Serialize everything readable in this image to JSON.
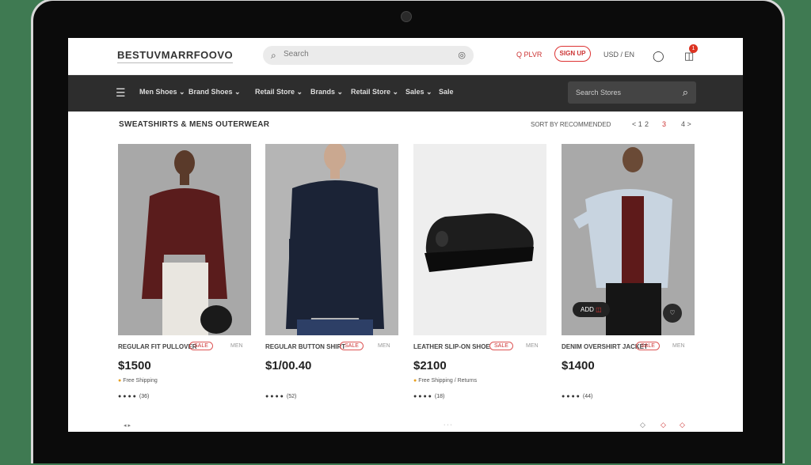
{
  "header": {
    "brand": "BESTUVMARRFOOVO",
    "search_placeholder": "Search",
    "search_icon": "search-icon",
    "mic_icon": "camera-icon",
    "help_label": "Q PLVR",
    "signin_label": "SIGN UP",
    "lang_label": "USD / EN",
    "account_icon": "user-icon",
    "cart_icon": "bag-icon",
    "cart_count": "1"
  },
  "nav": {
    "items": [
      "Men Shoes ⌄",
      "Brand Shoes ⌄",
      "Retail Store ⌄",
      "Brands ⌄",
      "Retail Store ⌄",
      "Sales ⌄",
      "Sale"
    ],
    "search_placeholder": "Search Stores"
  },
  "section": {
    "title": "SWEATSHIRTS & MENS OUTERWEAR",
    "sort_label": "SORT BY RECOMMENDED",
    "pages": [
      "< 1",
      "2",
      "3",
      "4 >"
    ]
  },
  "products": [
    {
      "name": "REGULAR FIT PULLOVER",
      "badge": "SALE",
      "meta": "MEN",
      "price": "$1500",
      "shipping": "Free Shipping",
      "rating_stars": "●●●●",
      "rating_count": "(36)"
    },
    {
      "name": "REGULAR BUTTON SHIRT",
      "badge": "SALE",
      "meta": "MEN",
      "price": "$1/00.40",
      "shipping": "",
      "rating_stars": "●●●●",
      "rating_count": "(52)"
    },
    {
      "name": "LEATHER SLIP-ON SHOE",
      "badge": "SALE",
      "meta": "MEN",
      "price": "$2100",
      "shipping": "Free Shipping / Returns",
      "rating_stars": "●●●●",
      "rating_count": "(18)"
    },
    {
      "name": "DENIM OVERSHIRT JACKET",
      "badge": "SALE",
      "meta": "MEN",
      "price": "$1400",
      "shipping": "",
      "rating_stars": "●●●●",
      "rating_count": "(44)"
    }
  ],
  "quick_actions": {
    "add_label": "ADD",
    "wishlist_icon": "heart-icon"
  },
  "footer": {
    "left": "◂ ▸",
    "mid": "· · ·",
    "icons": [
      "◇",
      "◇",
      "◇"
    ]
  },
  "colors": {
    "accent": "#cc3333",
    "nav_bg": "#2d2d2d",
    "badge": "#dd3322"
  }
}
